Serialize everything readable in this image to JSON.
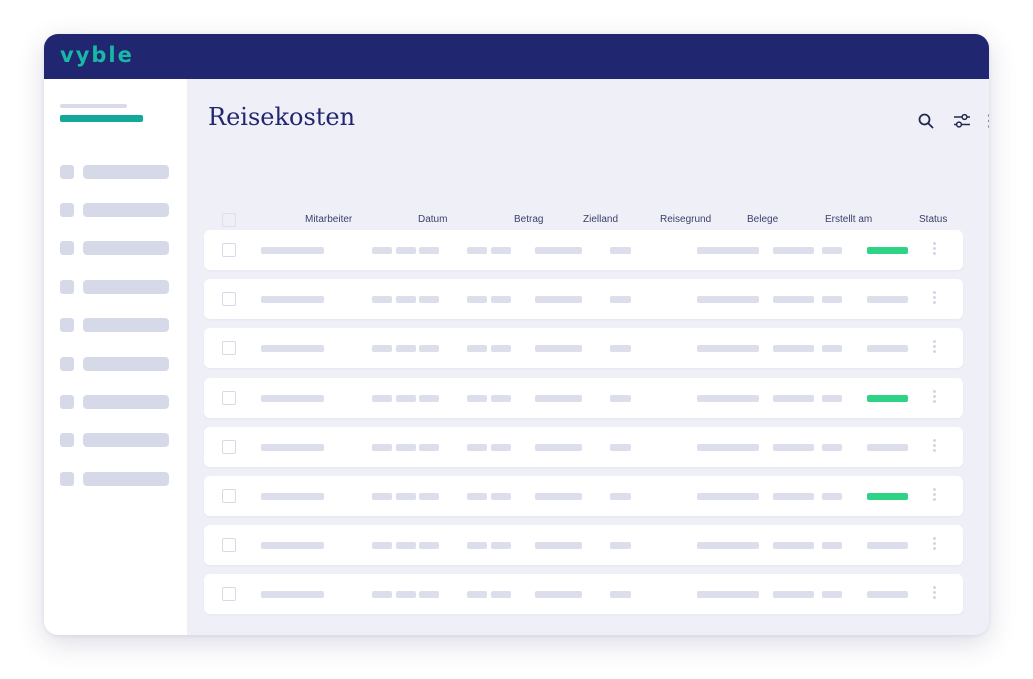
{
  "app": {
    "logo": "vyble"
  },
  "page": {
    "title": "Reisekosten"
  },
  "toolbar": {
    "icons": [
      "search-icon",
      "filter-sliders-icon",
      "more-vertical-icon"
    ]
  },
  "table": {
    "columns": [
      "Mitarbeiter",
      "Datum",
      "Betrag",
      "Zielland",
      "Reisegrund",
      "Belege",
      "Erstellt am",
      "Status"
    ],
    "rows": [
      {
        "status_active": true
      },
      {
        "status_active": false
      },
      {
        "status_active": false
      },
      {
        "status_active": true
      },
      {
        "status_active": false
      },
      {
        "status_active": true
      },
      {
        "status_active": false
      },
      {
        "status_active": false
      }
    ]
  },
  "colors": {
    "topbar": "#212670",
    "brand": "#19b8a6",
    "sidebar_active": "#13a89a",
    "title": "#212670",
    "status_active": "#2ed386",
    "placeholder": "#dcdeeb"
  }
}
